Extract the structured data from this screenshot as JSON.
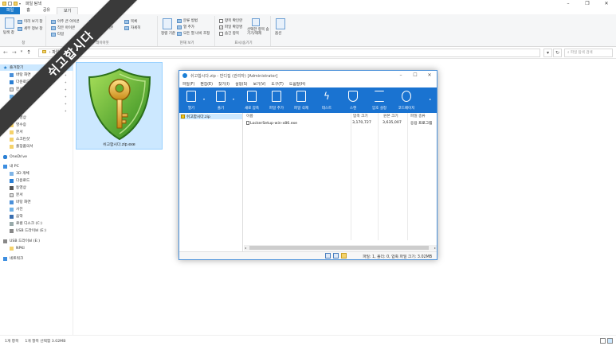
{
  "explorer": {
    "title": "파일 탐색",
    "tabs": [
      "파일",
      "홈",
      "공유",
      "보기"
    ],
    "ribbon": {
      "nav_pane": "탐색 창",
      "preview": "미리 보기 창",
      "details_pane": "세부 정보 창",
      "pane_group": "창",
      "very_large": "아주 큰 아이콘",
      "large": "큰 아이콘",
      "small": "작은 아이콘",
      "medium": "보통 아이콘",
      "tiles": "타일",
      "content": "내용",
      "list": "목록",
      "details": "자세히",
      "layout_group": "레이아웃",
      "sort": "정렬 기준",
      "group_by": "분류 방법",
      "add_columns": "열 추가",
      "fit_columns": "모든 열 너비 조정",
      "current_view_group": "현재 보기",
      "item_checkbox": "항목 확인란",
      "file_ext": "파일 확장명",
      "hidden_items": "숨긴 항목",
      "hide_selected": "선택한 항목 숨기기/해제",
      "showhide_group": "표시/숨기기",
      "options": "옵션"
    },
    "address": "파일 탐색",
    "search_placeholder": "파일 탐색 검색",
    "nav": {
      "quick_access": "즐겨찾기",
      "desktop": "바탕 화면",
      "downloads": "다운로드",
      "documents": "문서",
      "pictures": "사진",
      "this_pc_q": "내 PC",
      "music": "음악",
      "video_q": "동영상",
      "receipts": "영수증",
      "docs2": "문서",
      "screenshots": "스크린샷",
      "attendance": "출장품의서",
      "onedrive": "OneDrive",
      "this_pc": "내 PC",
      "objects3d": "3D 개체",
      "downloads2": "다운로드",
      "videos": "동영상",
      "documents2": "문서",
      "desktop2": "바탕 화면",
      "pictures2": "사진",
      "music2": "음악",
      "local_disk": "로컬 디스크 (C:)",
      "usb_e": "USB 드라이브 (E:)",
      "usb_e2": "USB 드라이브 (E:)",
      "npki": "NPKI",
      "network": "네트워크"
    },
    "file_name": "쉬고합시다.zip.exe",
    "status": {
      "count": "1개 항목",
      "selected": "1개 항목 선택함 3.02MB"
    }
  },
  "banner": "쉬고합시다",
  "bandizip": {
    "title": "쉬고합시다.zip - 반디집 (관리자) [Administrator]",
    "menu": [
      "파일(F)",
      "편집(E)",
      "찾기(I)",
      "설정(S)",
      "보기(V)",
      "도구(T)",
      "도움말(H)"
    ],
    "toolbar": [
      "열기",
      "풀기",
      "새로 압축",
      "파일 추가",
      "파일 삭제",
      "테스트",
      "스캔",
      "암호 설정",
      "코드페이지"
    ],
    "tree_root": "쉬고합시다.zip",
    "columns": [
      "이름",
      "압축 크기",
      "원본 크기",
      "파일 종류"
    ],
    "rows": [
      {
        "name": "LockerSetup-win-x86.exe",
        "packed": "3,170,727",
        "original": "3,635,007",
        "type": "응용 프로그램"
      }
    ],
    "status": "파일: 1, 폴더: 0, 압축 파일 크기: 3.02MB"
  },
  "colors": {
    "accent": "#1979ca",
    "toolbar_blue": "#1a73d1",
    "selection": "#cce8ff",
    "banner": "#3a3a3a"
  }
}
